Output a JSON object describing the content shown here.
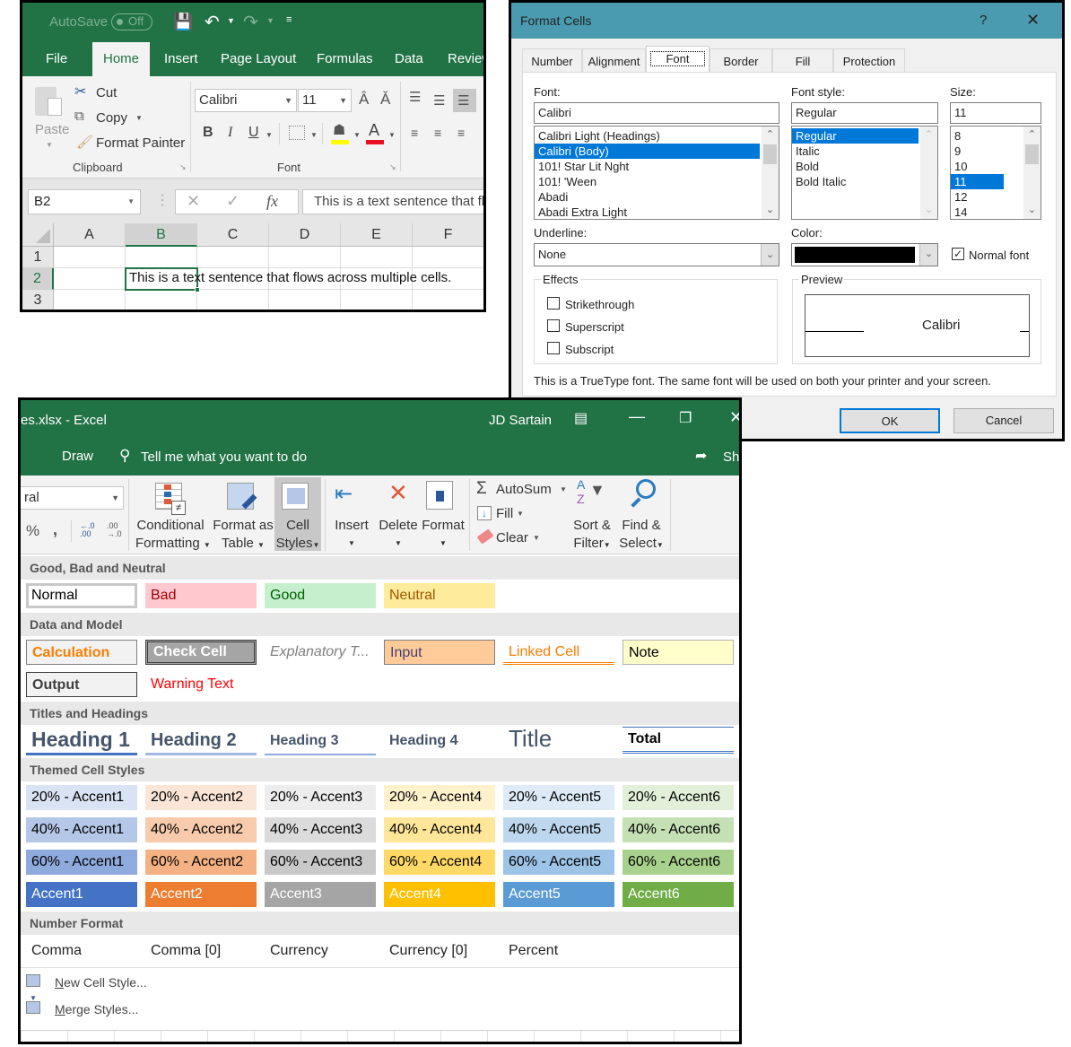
{
  "window1": {
    "qat": {
      "autosave_label": "AutoSave",
      "autosave_state": "Off"
    },
    "tabs": [
      "File",
      "Home",
      "Insert",
      "Page Layout",
      "Formulas",
      "Data",
      "Review"
    ],
    "active_tab": "Home",
    "clipboard": {
      "paste": "Paste",
      "cut": "Cut",
      "copy": "Copy",
      "format_painter": "Format Painter",
      "group_label": "Clipboard"
    },
    "font": {
      "font_name": "Calibri",
      "font_size": "11",
      "bold": "B",
      "italic": "I",
      "underline": "U",
      "group_label": "Font",
      "fill_color": "#ffff00",
      "font_color": "#e81123"
    },
    "formula_bar": {
      "name_box": "B2",
      "content": "This is a text sentence that flows across multiple cells."
    },
    "grid": {
      "columns": [
        "A",
        "B",
        "C",
        "D",
        "E",
        "F"
      ],
      "rows": [
        "1",
        "2",
        "3"
      ],
      "selected_cell": "B2",
      "b2_text": "This is a text sentence that flows across multiple cells."
    }
  },
  "window2": {
    "title": "Format Cells",
    "help": "?",
    "tabs": [
      "Number",
      "Alignment",
      "Font",
      "Border",
      "Fill",
      "Protection"
    ],
    "active_tab": "Font",
    "font_label": "Font:",
    "font_value": "Calibri",
    "font_list": [
      "Calibri Light (Headings)",
      "Calibri (Body)",
      "101! Star Lit Nght",
      "101! 'Ween",
      "Abadi",
      "Abadi Extra Light"
    ],
    "font_list_selected": "Calibri (Body)",
    "style_label": "Font style:",
    "style_value": "Regular",
    "style_list": [
      "Regular",
      "Italic",
      "Bold",
      "Bold Italic"
    ],
    "style_list_selected": "Regular",
    "size_label": "Size:",
    "size_value": "11",
    "size_list": [
      "8",
      "9",
      "10",
      "11",
      "12",
      "14"
    ],
    "size_list_selected": "11",
    "underline_label": "Underline:",
    "underline_value": "None",
    "color_label": "Color:",
    "color_value": "#000000",
    "normal_font_label": "Normal font",
    "normal_font_checked": true,
    "effects_label": "Effects",
    "effects": [
      {
        "label": "Strikethrough",
        "checked": false
      },
      {
        "label": "Superscript",
        "checked": false
      },
      {
        "label": "Subscript",
        "checked": false
      }
    ],
    "preview_label": "Preview",
    "preview_text": "Calibri",
    "info_text": "This is a TrueType font.  The same font will be used on both your printer and your screen.",
    "ok": "OK",
    "cancel": "Cancel"
  },
  "window3": {
    "title": "es.xlsx  -  Excel",
    "user": "JD Sartain",
    "draw_tab": "Draw",
    "tell_me": "Tell me what you want to do",
    "share": "Sha",
    "number_format_value": "ral",
    "ribbon": {
      "conditional": [
        "Conditional",
        "Formatting"
      ],
      "format_table": [
        "Format as",
        "Table"
      ],
      "cell_styles": [
        "Cell",
        "Styles"
      ],
      "insert": "Insert",
      "delete": "Delete",
      "format": "Format",
      "autosum": "AutoSum",
      "fill": "Fill",
      "clear": "Clear",
      "sort": [
        "Sort &",
        "Filter"
      ],
      "find": [
        "Find &",
        "Select"
      ]
    },
    "sections": {
      "good_bad": "Good, Bad and Neutral",
      "data_model": "Data and Model",
      "titles": "Titles and Headings",
      "themed": "Themed Cell Styles",
      "number": "Number Format"
    },
    "good_bad_styles": [
      {
        "label": "Normal",
        "bg": "#ffffff",
        "fg": "#000000"
      },
      {
        "label": "Bad",
        "bg": "#ffc7ce",
        "fg": "#9c0006"
      },
      {
        "label": "Good",
        "bg": "#c6efce",
        "fg": "#006100"
      },
      {
        "label": "Neutral",
        "bg": "#ffeb9c",
        "fg": "#9c5700"
      }
    ],
    "data_model_styles": [
      {
        "label": "Calculation",
        "bg": "#f2f2f2",
        "fg": "#fa7d00"
      },
      {
        "label": "Check Cell",
        "bg": "#a5a5a5",
        "fg": "#ffffff"
      },
      {
        "label": "Explanatory T...",
        "bg": "#ffffff",
        "fg": "#7f7f7f"
      },
      {
        "label": "Input",
        "bg": "#ffcc99",
        "fg": "#3f3f76"
      },
      {
        "label": "Linked Cell",
        "bg": "#ffffff",
        "fg": "#fa7d00"
      },
      {
        "label": "Note",
        "bg": "#ffffcc",
        "fg": "#000000"
      },
      {
        "label": "Output",
        "bg": "#f2f2f2",
        "fg": "#3f3f3f"
      },
      {
        "label": "Warning Text",
        "bg": "#ffffff",
        "fg": "#ff0000"
      }
    ],
    "title_styles": [
      "Heading 1",
      "Heading 2",
      "Heading 3",
      "Heading 4",
      "Title",
      "Total"
    ],
    "themed_rows": [
      {
        "prefix": "20% - ",
        "bgs": [
          "#dae3f3",
          "#fbe5d6",
          "#ededed",
          "#fff2cc",
          "#deebf7",
          "#e2f0d9"
        ],
        "fg": "#000000"
      },
      {
        "prefix": "40% - ",
        "bgs": [
          "#b4c7e7",
          "#f8cbad",
          "#dbdbdb",
          "#ffe699",
          "#bdd7ee",
          "#c5e0b4"
        ],
        "fg": "#000000"
      },
      {
        "prefix": "60% - ",
        "bgs": [
          "#8faadc",
          "#f4b183",
          "#c9c9c9",
          "#ffd966",
          "#9dc3e6",
          "#a9d18e"
        ],
        "fg": "#000000"
      },
      {
        "prefix": "",
        "bgs": [
          "#4472c4",
          "#ed7d31",
          "#a5a5a5",
          "#ffc000",
          "#5b9bd5",
          "#70ad47"
        ],
        "fg": "#ffffff"
      }
    ],
    "accents": [
      "Accent1",
      "Accent2",
      "Accent3",
      "Accent4",
      "Accent5",
      "Accent6"
    ],
    "number_styles": [
      "Comma",
      "Comma [0]",
      "Currency",
      "Currency [0]",
      "Percent"
    ],
    "menu": [
      "New Cell Style...",
      "Merge Styles..."
    ]
  }
}
